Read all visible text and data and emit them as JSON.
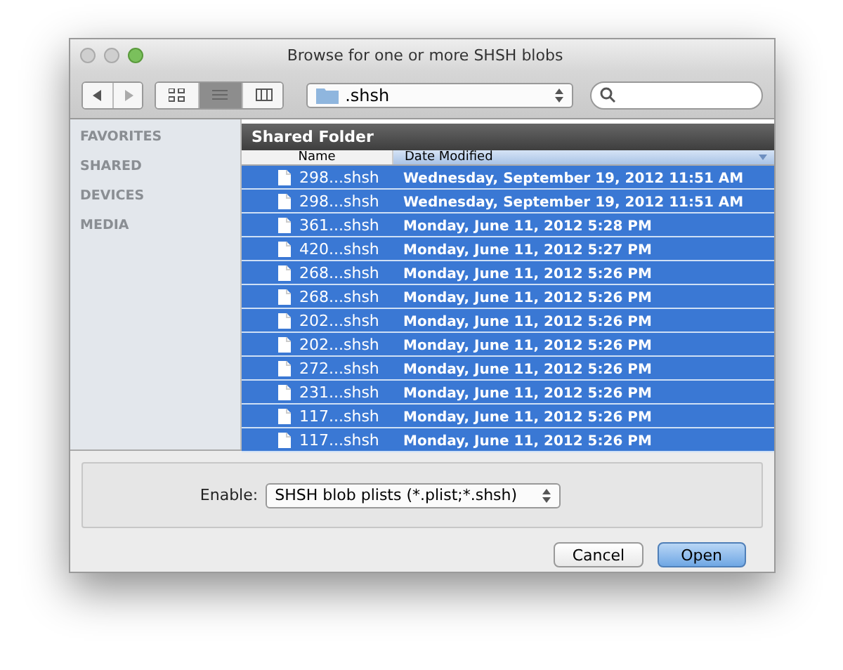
{
  "window": {
    "title": "Browse for one or more SHSH blobs"
  },
  "toolbar": {
    "view_modes": [
      {
        "kind": "icons",
        "selected": false
      },
      {
        "kind": "list",
        "selected": true
      },
      {
        "kind": "columns",
        "selected": false
      }
    ],
    "location": ".shsh"
  },
  "sidebar": {
    "sections": [
      "FAVORITES",
      "SHARED",
      "DEVICES",
      "MEDIA"
    ]
  },
  "table": {
    "title": "Shared Folder",
    "columns": [
      {
        "label": "Name",
        "sorted": false
      },
      {
        "label": "Date Modified",
        "sorted": true
      }
    ],
    "rows": [
      {
        "name": "298...shsh",
        "date": "Wednesday, September 19, 2012 11:51 AM",
        "selected": true
      },
      {
        "name": "298...shsh",
        "date": "Wednesday, September 19, 2012 11:51 AM",
        "selected": true
      },
      {
        "name": "361...shsh",
        "date": "Monday, June 11, 2012 5:28 PM",
        "selected": true
      },
      {
        "name": "420...shsh",
        "date": "Monday, June 11, 2012 5:27 PM",
        "selected": true
      },
      {
        "name": "268...shsh",
        "date": "Monday, June 11, 2012 5:26 PM",
        "selected": true
      },
      {
        "name": "268...shsh",
        "date": "Monday, June 11, 2012 5:26 PM",
        "selected": true
      },
      {
        "name": "202...shsh",
        "date": "Monday, June 11, 2012 5:26 PM",
        "selected": true
      },
      {
        "name": "202...shsh",
        "date": "Monday, June 11, 2012 5:26 PM",
        "selected": true
      },
      {
        "name": "272...shsh",
        "date": "Monday, June 11, 2012 5:26 PM",
        "selected": true
      },
      {
        "name": "231...shsh",
        "date": "Monday, June 11, 2012 5:26 PM",
        "selected": true
      },
      {
        "name": "117...shsh",
        "date": "Monday, June 11, 2012 5:26 PM",
        "selected": true
      },
      {
        "name": "117...shsh",
        "date": "Monday, June 11, 2012 5:26 PM",
        "selected": true
      }
    ]
  },
  "filter": {
    "label": "Enable:",
    "value": "SHSH blob plists (*.plist;*.shsh)"
  },
  "buttons": [
    {
      "label": "Cancel",
      "default": false
    },
    {
      "label": "Open",
      "default": true
    }
  ]
}
